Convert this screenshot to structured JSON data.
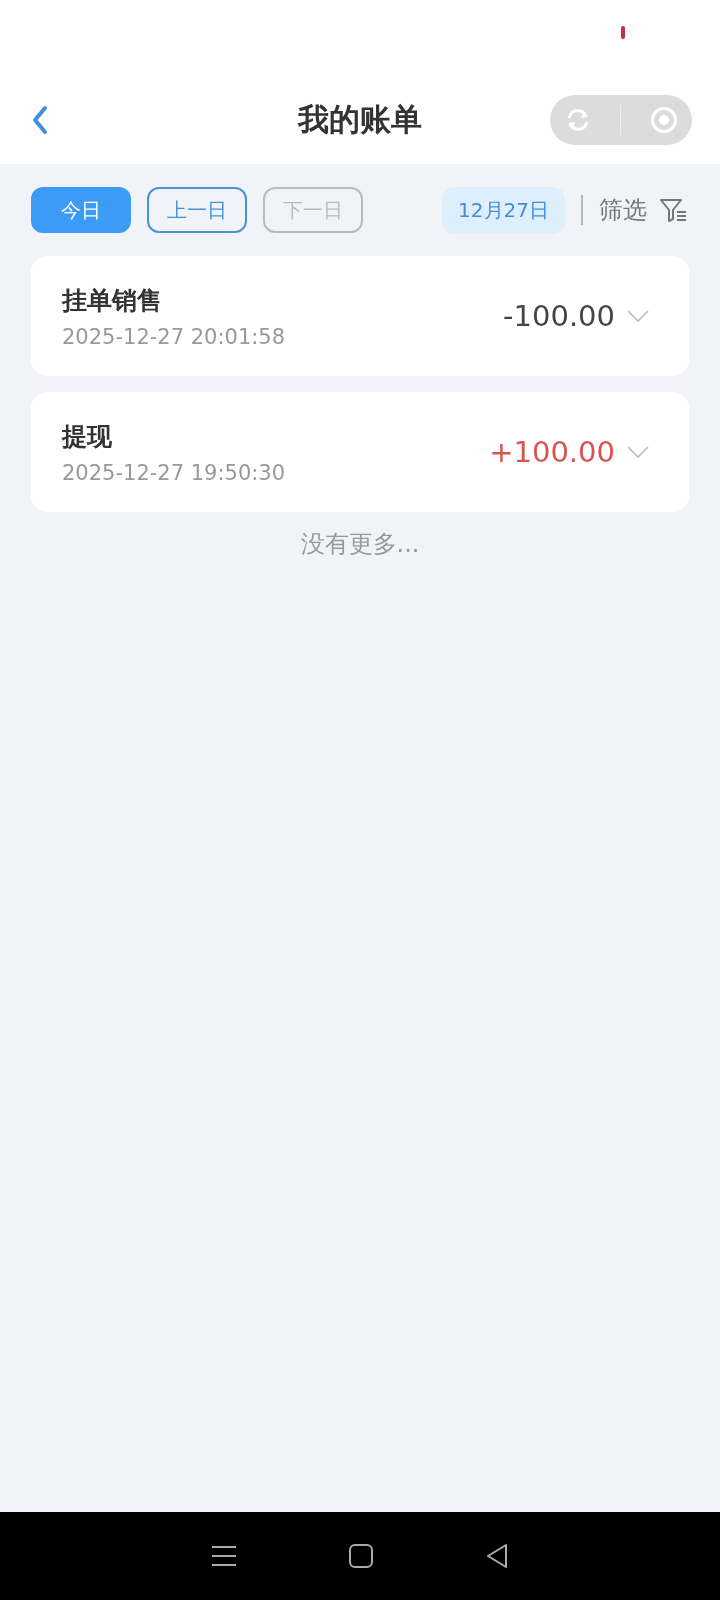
{
  "header": {
    "title": "我的账单"
  },
  "day_buttons": [
    {
      "label": "今日",
      "selected": true,
      "disabled": false
    },
    {
      "label": "上一日",
      "selected": false,
      "disabled": false
    },
    {
      "label": "下一日",
      "selected": false,
      "disabled": true
    }
  ],
  "date_chip": "12月27日",
  "filter": {
    "label": "筛选"
  },
  "transactions": [
    {
      "title": "挂单销售",
      "time": "2025-12-27 20:01:58",
      "amount": "-100.00",
      "kind": "expense"
    },
    {
      "title": "提现",
      "time": "2025-12-27 19:50:30",
      "amount": "+100.00",
      "kind": "income"
    }
  ],
  "footer_note": "没有更多..."
}
